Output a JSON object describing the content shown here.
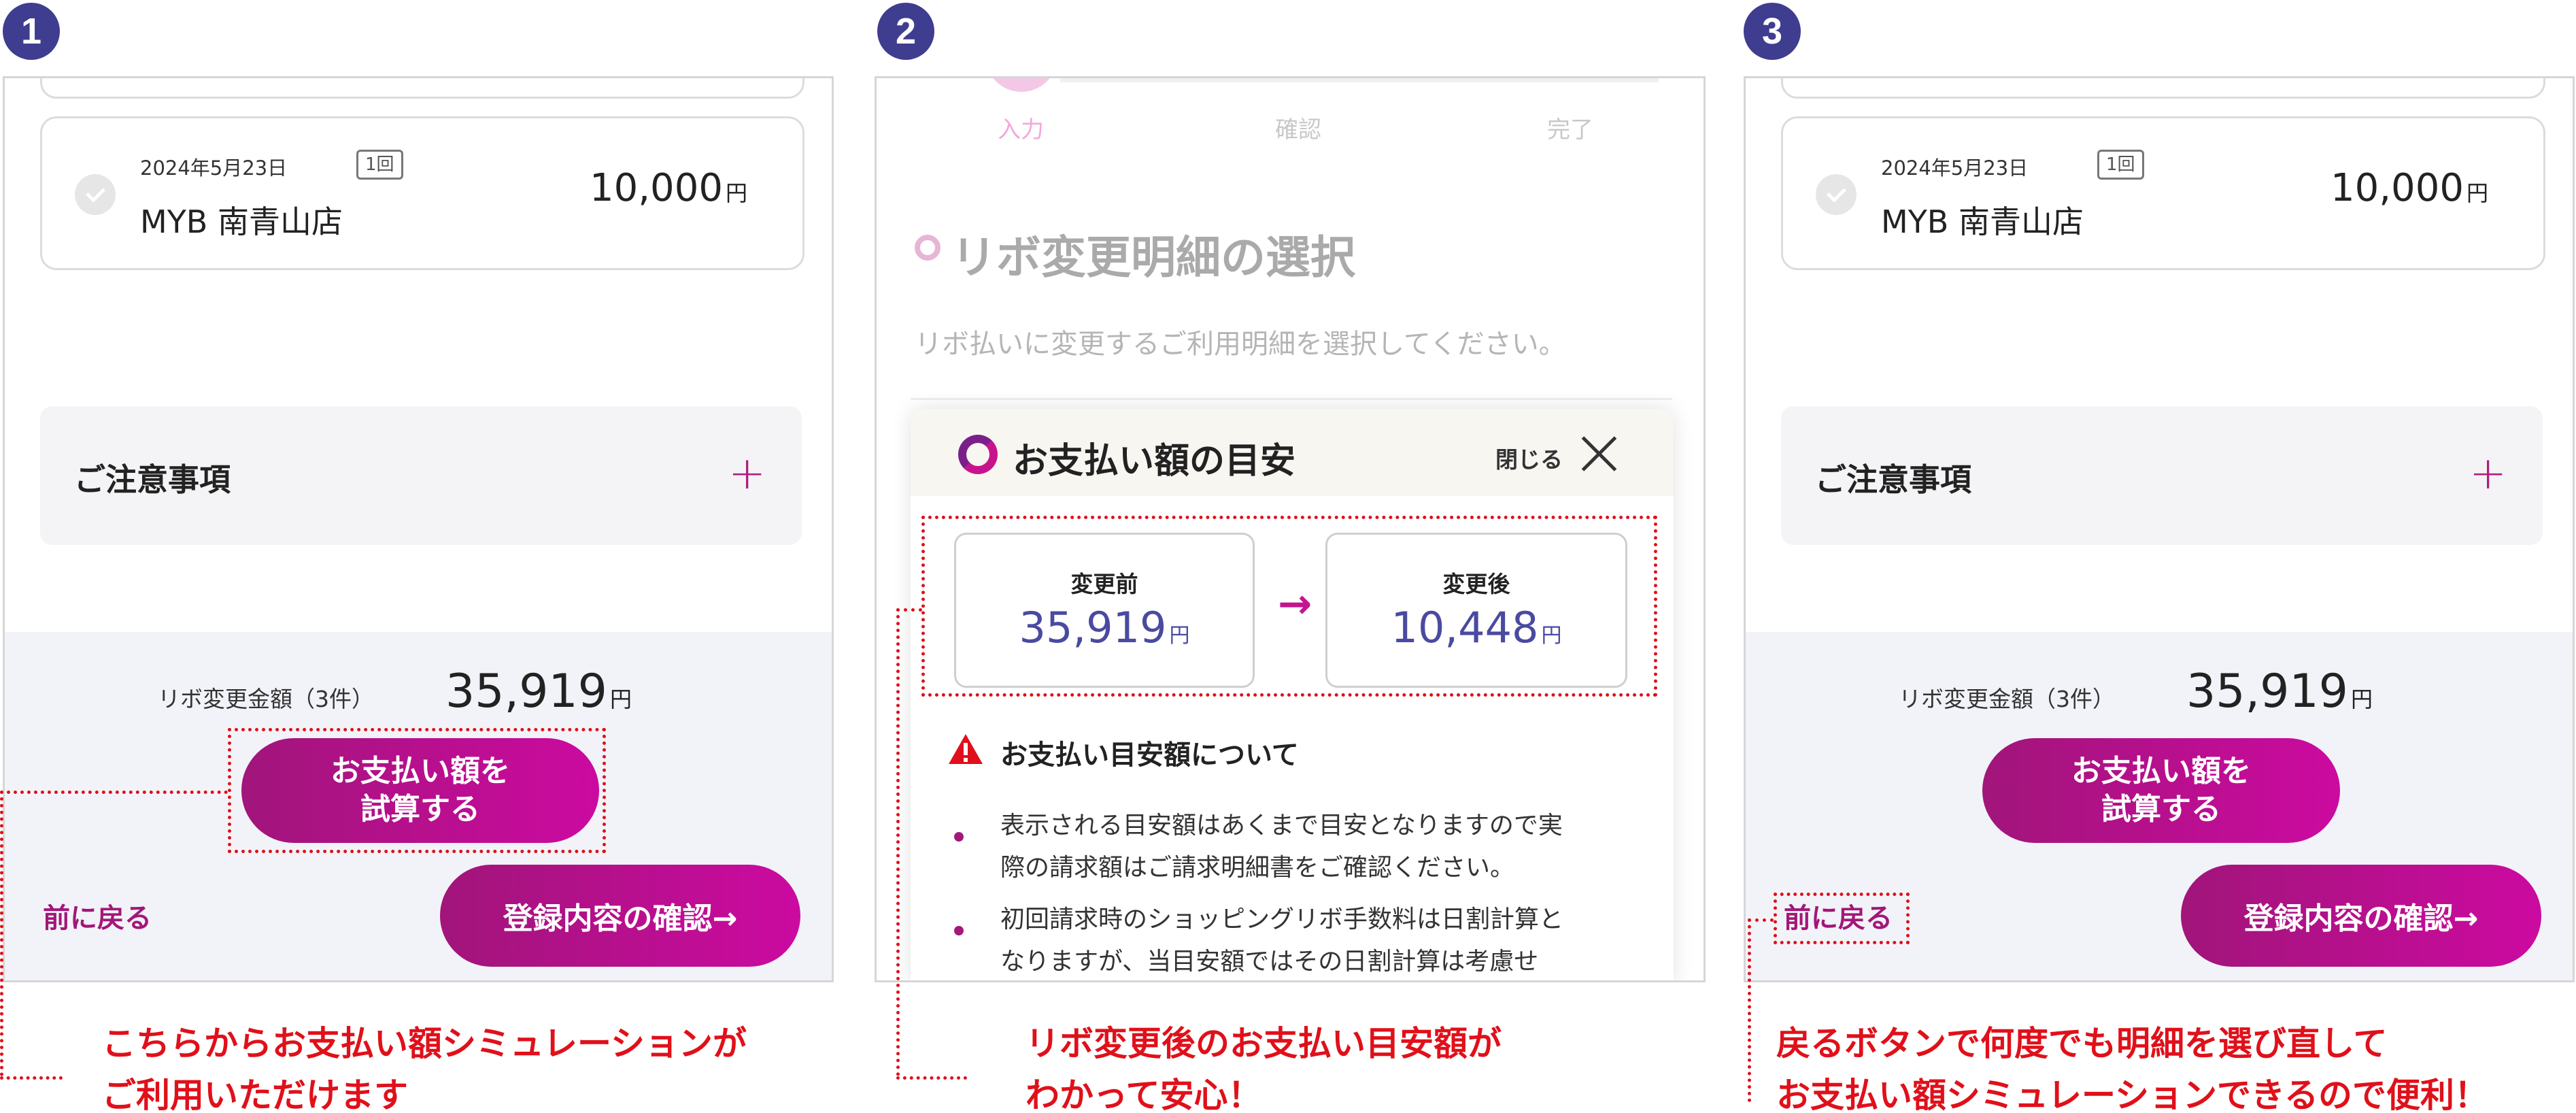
{
  "colors": {
    "accent": "#b01d7f",
    "step_badge": "#3f3d8f",
    "callout_red": "#e0101a",
    "value_blue": "#4a4aa0"
  },
  "steps": [
    "1",
    "2",
    "3"
  ],
  "transaction": {
    "date": "2024年5月23日",
    "times": "1回",
    "store": "MYB 南青山店",
    "amount": "10,000",
    "currency": "円"
  },
  "notice_label": "ご注意事項",
  "footer": {
    "revo_label": "リボ変更金額（3件）",
    "revo_amount": "35,919",
    "currency": "円",
    "simulate_line1": "お支払い額を",
    "simulate_line2": "試算する",
    "back": "前に戻る",
    "confirm": "登録内容の確認→"
  },
  "panel2": {
    "progress": [
      "入力",
      "確認",
      "完了"
    ],
    "section_title": "リボ変更明細の選択",
    "subtext": "リボ払いに変更するご利用明細を選択してください。",
    "modal": {
      "title": "お支払い額の目安",
      "close": "閉じる",
      "before_label": "変更前",
      "before_value": "35,919",
      "after_label": "変更後",
      "after_value": "10,448",
      "currency": "円",
      "warning_title": "お支払い目安額について",
      "bullet1_line1": "表示される目安額はあくまで目安となりますので実",
      "bullet1_line2": "際の請求額はご請求明細書をご確認ください。",
      "bullet2_line1": "初回請求時のショッピングリボ手数料は日割計算と",
      "bullet2_line2": "なりますが、当目安額ではその日割計算は考慮せ"
    }
  },
  "captions": {
    "c1_line1": "こちらからお支払い額シミュレーションが",
    "c1_line2": "ご利用いただけます",
    "c2_line1": "リボ変更後のお支払い目安額が",
    "c2_line2": "わかって安心！",
    "c3_line1": "戻るボタンで何度でも明細を選び直して",
    "c3_line2": "お支払い額シミュレーションできるので便利！"
  }
}
